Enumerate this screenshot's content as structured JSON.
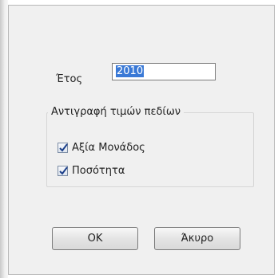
{
  "dialog": {
    "year_label": "Έτος",
    "year_value": "2010",
    "group_title": "Αντιγραφή τιμών πεδίων",
    "options": [
      {
        "label": "Αξία Μονάδος",
        "checked": true
      },
      {
        "label": "Ποσότητα",
        "checked": true
      }
    ],
    "ok_label": "OK",
    "cancel_label": "Άκυρο"
  },
  "colors": {
    "selection": "#3a79d6",
    "dialog_bg": "#f0f0f0"
  }
}
